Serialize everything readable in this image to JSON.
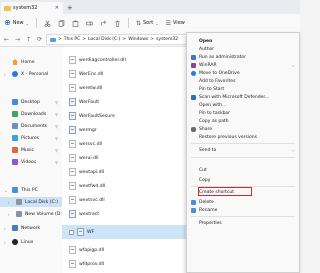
{
  "window": {
    "tab_title": "system32",
    "close_glyph": "✕",
    "newtab_glyph": "+"
  },
  "commandbar": {
    "new_label": "New",
    "sort_label": "Sort",
    "view_label": "View"
  },
  "address": {
    "back_glyph": "←",
    "forward_glyph": "→",
    "up_glyph": "↑",
    "refresh_glyph": "⟳",
    "crumbs": [
      "This PC",
      "Local Disk (C:)",
      "Windows",
      "system32"
    ],
    "separator": ">"
  },
  "sidebar": {
    "items": [
      {
        "label": "Home",
        "icon": "home-icon"
      },
      {
        "label": "X - Personal",
        "icon": "onedrive-icon"
      },
      {
        "label": "Desktop",
        "icon": "desktop-icon"
      },
      {
        "label": "Downloads",
        "icon": "downloads-icon"
      },
      {
        "label": "Documents",
        "icon": "documents-icon"
      },
      {
        "label": "Pictures",
        "icon": "pictures-icon"
      },
      {
        "label": "Music",
        "icon": "music-icon"
      },
      {
        "label": "Videos",
        "icon": "videos-icon"
      },
      {
        "label": "This PC",
        "icon": "pc-icon"
      },
      {
        "label": "Local Disk (C:)",
        "icon": "drive-icon"
      },
      {
        "label": "New Volume (D:)",
        "icon": "drive-icon"
      },
      {
        "label": "Network",
        "icon": "network-icon"
      },
      {
        "label": "Linux",
        "icon": "linux-icon"
      }
    ]
  },
  "files": [
    "werdiagcontroller.dll",
    "WerEnc.dll",
    "weretw.dll",
    "WerFault",
    "WerFaultSecure",
    "wermgr",
    "wersvc.dll",
    "werui.dll",
    "wevtapi.dll",
    "wevtfwd.dll",
    "wevtsvc.dll",
    "wextract",
    "wfapigp.dll",
    "wfdprov.dll"
  ],
  "selected_file": "WF",
  "context_menu": {
    "items": {
      "open": "Open",
      "author": "Author",
      "run_admin": "Run as administrator",
      "winrar": "WinRAR",
      "onedrive": "Move to OneDrive",
      "favorites": "Add to Favorites",
      "pin_start": "Pin to Start",
      "defender": "Scan with Microsoft Defender...",
      "open_with": "Open with...",
      "pin_taskbar": "Pin to taskbar",
      "copy_path": "Copy as path",
      "share": "Share",
      "restore": "Restore previous versions",
      "send_to": "Send to",
      "cut": "Cut",
      "copy": "Copy",
      "create_shortcut": "Create shortcut",
      "delete": "Delete",
      "rename": "Rename",
      "properties": "Properties"
    },
    "highlight_color": "#d9262b"
  }
}
